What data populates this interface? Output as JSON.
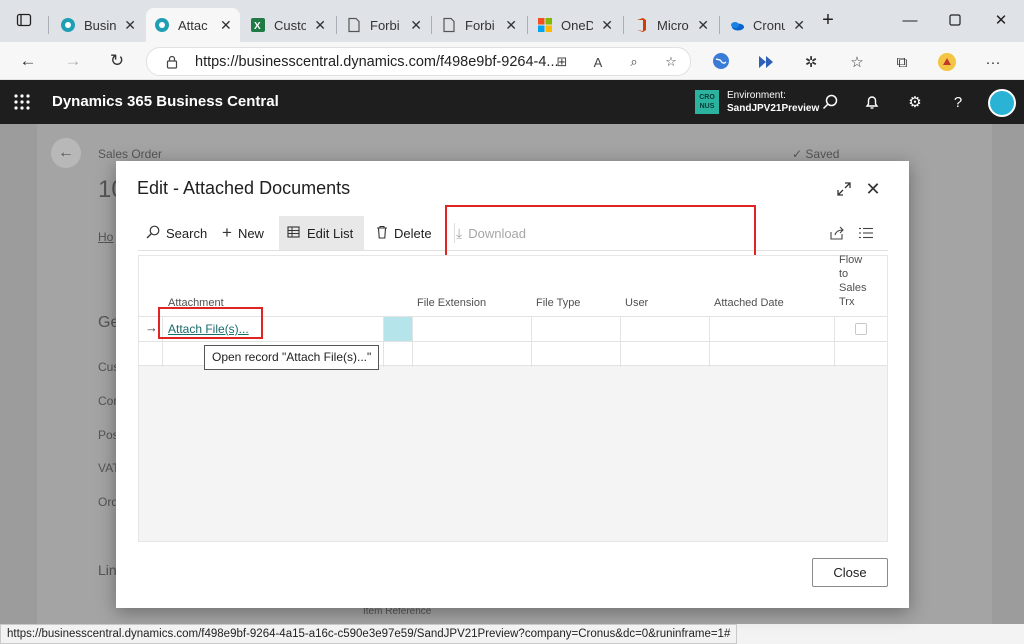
{
  "browser": {
    "tabs": [
      {
        "label": "Busin",
        "icon": "bc-icon"
      },
      {
        "label": "Attac",
        "icon": "bc-icon"
      },
      {
        "label": "Custo",
        "icon": "excel-icon"
      },
      {
        "label": "Forbi",
        "icon": "page-icon"
      },
      {
        "label": "Forbi",
        "icon": "page-icon"
      },
      {
        "label": "OneD",
        "icon": "microsoft-icon"
      },
      {
        "label": "Micro",
        "icon": "office-icon"
      },
      {
        "label": "Cronu",
        "icon": "onedrive-icon"
      }
    ],
    "url": "https://businesscentral.dynamics.com/f498e9bf-9264-4..."
  },
  "appbar": {
    "title": "Dynamics 365 Business Central",
    "env_badge_line1": "CRO",
    "env_badge_line2": "NUS",
    "env_label": "Environment:",
    "env_name": "SandJPV21Preview"
  },
  "background_page": {
    "page_type": "Sales Order",
    "number_partial": "10",
    "tab_partial": "Ho",
    "section_partial": "Ge",
    "fields_partial": [
      "Cus",
      "Cor",
      "Pos",
      "VAT",
      "Ord"
    ],
    "lines_partial": "Lin",
    "status": "Saved",
    "footer_label": "Item Reference"
  },
  "dialog": {
    "title": "Edit - Attached Documents",
    "actions": {
      "search": "Search",
      "new": "New",
      "edit_list": "Edit List",
      "delete": "Delete",
      "download": "Download"
    },
    "columns": {
      "attachment": "Attachment",
      "file_extension": "File Extension",
      "file_type": "File Type",
      "user": "User",
      "attached_date": "Attached Date",
      "flow_1": "Flow",
      "flow_2": "to",
      "flow_3": "Sales",
      "flow_4": "Trx"
    },
    "row": {
      "attach_link": "Attach File(s)..."
    },
    "tooltip": "Open record \"Attach File(s)...\"",
    "close_label": "Close"
  },
  "statusbar": {
    "text": "https://businesscentral.dynamics.com/f498e9bf-9264-4a15-a16c-c590e3e97e59/SandJPV21Preview?company=Cronus&dc=0&runinframe=1#"
  },
  "colors": {
    "highlight_box": "#e02424",
    "link": "#1b6b6b",
    "appbar": "#1e1e1e",
    "env_badge": "#2bb3a0"
  }
}
